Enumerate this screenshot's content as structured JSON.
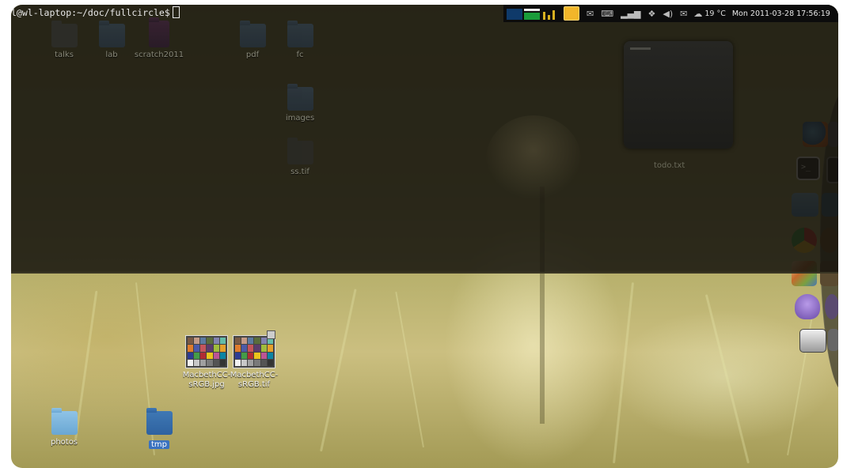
{
  "terminal": {
    "prompt": "l@wl-laptop:~/doc/fullcircle$"
  },
  "panel": {
    "weather": "19 °C",
    "clock": "Mon 2011-03-28 17:56:19",
    "icons": [
      "system-monitor-icon",
      "notes-icon",
      "mail-icon",
      "keyboard-icon",
      "network-icon",
      "dropbox-icon",
      "volume-icon",
      "messages-icon",
      "weather-icon"
    ]
  },
  "desktop_dim": {
    "icons": [
      {
        "label": "talks"
      },
      {
        "label": "lab"
      },
      {
        "label": "scratch2011"
      },
      {
        "label": "pdf"
      },
      {
        "label": "fc"
      },
      {
        "label": "images"
      },
      {
        "label": "ss.tif"
      }
    ],
    "doc_card_label": "todo.txt"
  },
  "desktop_bright": {
    "files": [
      {
        "label": "MacbethCC-sRGB.jpg"
      },
      {
        "label": "MacbethCC-sRGB.tif"
      }
    ],
    "folders": [
      {
        "label": "photos"
      },
      {
        "label": "tmp"
      }
    ]
  },
  "dock": {
    "apps": [
      "firefox-icon",
      "terminal-icon",
      "home-folder-icon",
      "chrome-icon",
      "gimp-icon",
      "pidgin-icon",
      "scanner-icon"
    ]
  },
  "colors": {
    "panel_bg": "#0c0c0c",
    "selection": "#3a72c0",
    "folder_light": "#8fc3e6",
    "folder_blue": "#3f78b4"
  }
}
